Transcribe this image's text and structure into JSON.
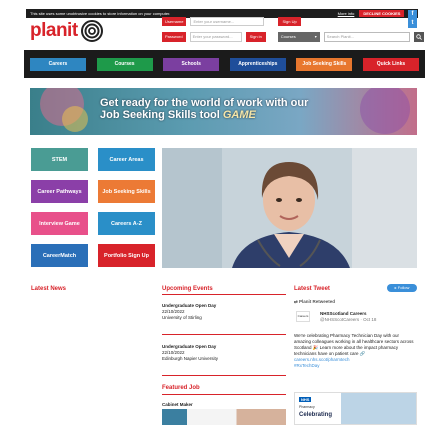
{
  "cookie_bar": {
    "message": "This site uses some unobtrusive cookies to store information on your computer.",
    "more_info": "More info",
    "decline": "DECLINE COOKIES",
    "close": "×"
  },
  "brand": {
    "name": "planit",
    "color": "#d8232a"
  },
  "login": {
    "username_label": "Username",
    "username_placeholder": "Enter your username...",
    "signup": "Sign Up",
    "password_label": "Password",
    "password_placeholder": "Enter your password...",
    "signin": "Sign in"
  },
  "search": {
    "select_value": "Courses",
    "placeholder": "Search Planit..."
  },
  "social_icons": [
    "facebook-icon",
    "twitter-icon"
  ],
  "nav": [
    {
      "label": "Careers",
      "color": "#2e86c1"
    },
    {
      "label": "Courses",
      "color": "#1e9a4a"
    },
    {
      "label": "Schools",
      "color": "#7b3fa0"
    },
    {
      "label": "Apprenticeships",
      "color": "#1f4e9a"
    },
    {
      "label": "Job Seeking Skills",
      "color": "#e8772e"
    },
    {
      "label": "Quick Links",
      "color": "#d8232a"
    }
  ],
  "banner": {
    "line1": "Get ready for the world of work with our",
    "line2": "Job Seeking Skills tool",
    "logo_text": "GAME"
  },
  "tiles": [
    {
      "label": "STEM",
      "color": "#4a9c94"
    },
    {
      "label": "Career Areas",
      "color": "#2a8fc8"
    },
    {
      "label": "Career Pathways",
      "color": "#8b3fa8"
    },
    {
      "label": "Job Seeking Skills",
      "color": "#ec7a35"
    },
    {
      "label": "Interview Game",
      "color": "#e8508a"
    },
    {
      "label": "Careers A-Z",
      "color": "#2a8fc8"
    },
    {
      "label": "CareerMatch",
      "color": "#2a6fb8"
    },
    {
      "label": "Portfolio Sign Up",
      "color": "#d8232a"
    }
  ],
  "sections": {
    "news": "Latest News",
    "events": "Upcoming Events",
    "tweet": "Latest Tweet",
    "job": "Featured Job"
  },
  "events": [
    {
      "title": "Undergraduate Open Day",
      "date": "22/10/2022",
      "place": "University of Stirling"
    },
    {
      "title": "Undergraduate Open Day",
      "date": "22/10/2022",
      "place": "Edinburgh Napier University"
    }
  ],
  "follow": "Follow",
  "tweet": {
    "retweeted": "Planit Retweeted",
    "name": "NHSScotland Careers",
    "handle": "@NHSScotCareers · Oct 18",
    "body": "We're celebrating Pharmacy Technician Day with our amazing colleagues working in all healthcare sectors across Scotland 🎉 Learn more about the impact pharmacy technicians have on patient care 🔗",
    "link": "careers.nhs.scot/pharmtech",
    "hashtag": "#RxTechDay",
    "avatar_text": "Careers",
    "card_badge": "NHS",
    "card_sub": "Pharmacy",
    "card_title": "Celebrating"
  },
  "job": {
    "title": "Cabinet Maker"
  }
}
